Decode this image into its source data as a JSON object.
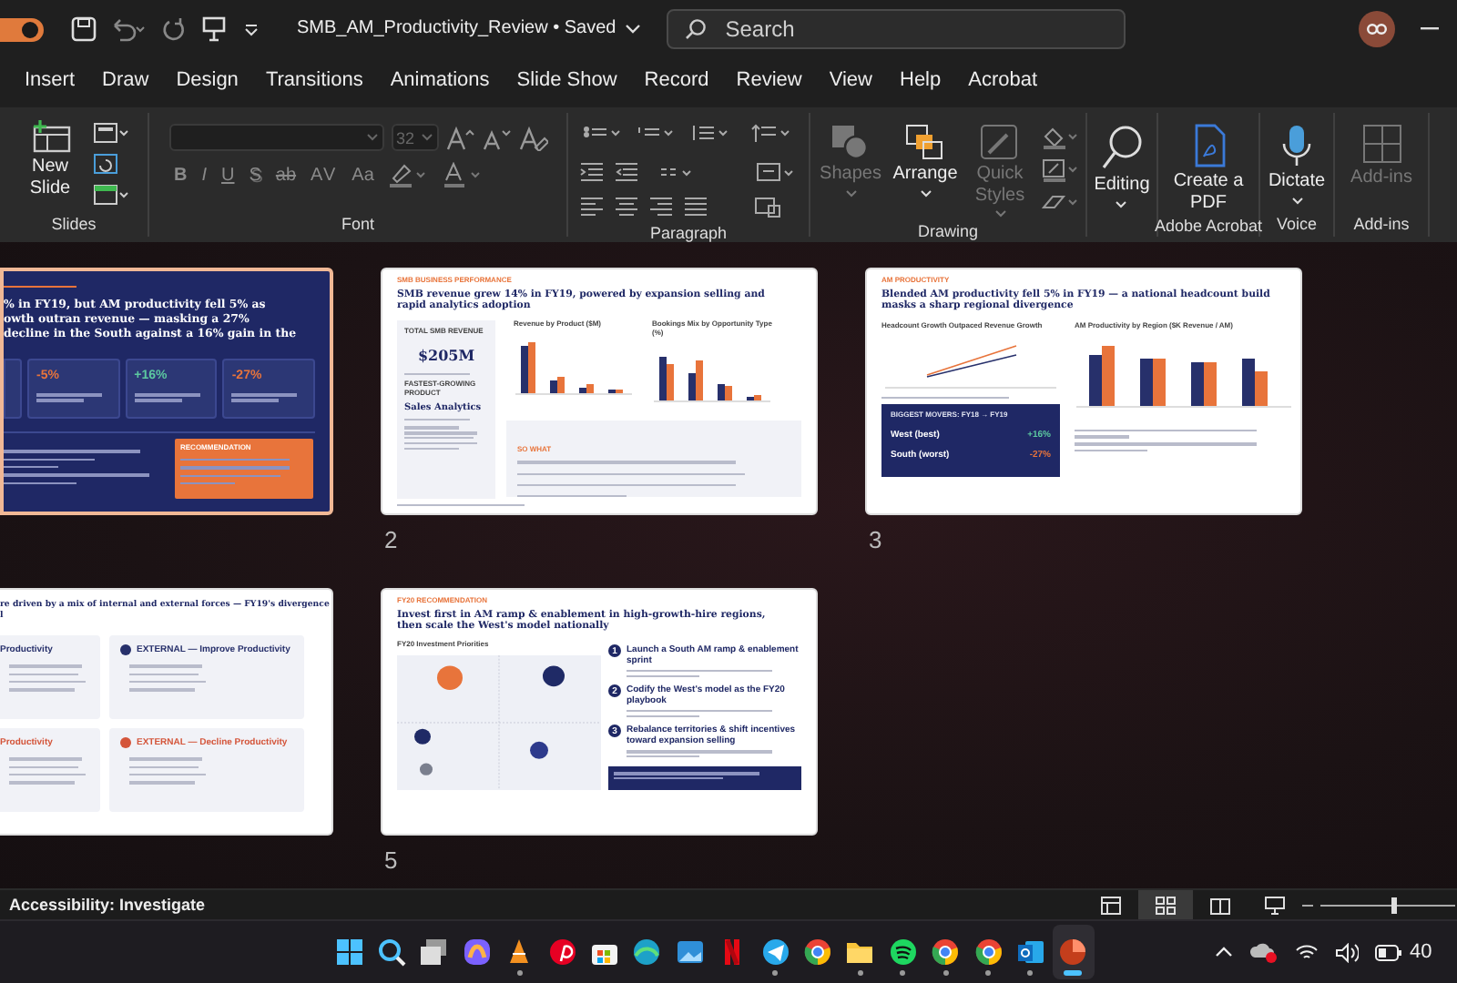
{
  "titlebar": {
    "autosave_on": true,
    "filename": "SMB_AM_Productivity_Review",
    "save_state": "• Saved",
    "search_placeholder": "Search"
  },
  "menu_tabs": [
    {
      "label": "Insert",
      "selected": false
    },
    {
      "label": "Draw",
      "selected": false
    },
    {
      "label": "Design",
      "selected": false
    },
    {
      "label": "Transitions",
      "selected": false
    },
    {
      "label": "Animations",
      "selected": false
    },
    {
      "label": "Slide Show",
      "selected": false
    },
    {
      "label": "Record",
      "selected": false
    },
    {
      "label": "Review",
      "selected": false
    },
    {
      "label": "View",
      "selected": false
    },
    {
      "label": "Help",
      "selected": false
    },
    {
      "label": "Acrobat",
      "selected": false
    }
  ],
  "ribbon": [
    {
      "kind": "slides",
      "label": "Slides",
      "buttons": [
        {
          "label": "New Slide",
          "disabled": false
        }
      ]
    },
    {
      "kind": "font",
      "label": "Font",
      "size": "32",
      "keys": [
        "B",
        "I",
        "U",
        "S",
        "ab",
        "AV",
        "Aa"
      ],
      "disabled": true
    },
    {
      "kind": "paragraph",
      "label": "Paragraph"
    },
    {
      "kind": "drawing",
      "label": "Drawing",
      "buttons": [
        {
          "label": "Shapes",
          "disabled": true
        },
        {
          "label": "Arrange",
          "disabled": false
        },
        {
          "label": "Quick Styles",
          "disabled": true
        }
      ]
    },
    {
      "kind": "single",
      "buttons": [
        {
          "label": "Editing",
          "disabled": false
        }
      ]
    },
    {
      "kind": "single",
      "label": "Adobe Acrobat",
      "buttons": [
        {
          "label": "Create a PDF",
          "disabled": false
        }
      ]
    },
    {
      "kind": "single",
      "label": "Voice",
      "buttons": [
        {
          "label": "Dictate",
          "disabled": false
        }
      ]
    },
    {
      "kind": "single",
      "label": "Add-ins",
      "buttons": [
        {
          "label": "Add-ins",
          "disabled": true
        }
      ]
    }
  ],
  "slides": [
    {
      "kind": "cover",
      "selected": true,
      "title_lines": [
        "% in FY19, but AM productivity fell 5% as",
        "owth outran revenue — masking a 27%",
        "decline in the South against a 16% gain in the"
      ],
      "stats": [
        {
          "value": "-5%",
          "color": "#e8743b"
        },
        {
          "value": "+16%",
          "color": "#5cc8a0"
        },
        {
          "value": "-27%",
          "color": "#e8743b"
        }
      ],
      "callout_label": "RECOMMENDATION"
    },
    {
      "kind": "dashboard",
      "selected": false,
      "number": "2",
      "eyebrow": "SMB BUSINESS PERFORMANCE",
      "title": "SMB revenue grew 14% in FY19, powered by expansion selling and rapid analytics adoption",
      "kpis": [
        {
          "label": "TOTAL SMB REVENUE",
          "value": "$205M"
        },
        {
          "label": "FASTEST-GROWING PRODUCT",
          "value": "Sales Analytics"
        }
      ],
      "charts": [
        "Revenue by Product ($M)",
        "Bookings Mix by Opportunity Type (%)"
      ],
      "callout_label": "SO WHAT"
    },
    {
      "kind": "regional",
      "selected": false,
      "number": "3",
      "eyebrow": "AM PRODUCTIVITY",
      "title": "Blended AM productivity fell 5% in FY19 — a national headcount build masks a sharp regional divergence",
      "charts": [
        "Headcount Growth Outpaced Revenue Growth",
        "AM Productivity by Region ($K Revenue / AM)"
      ],
      "movers_title": "BIGGEST MOVERS: FY18 → FY19",
      "movers": [
        {
          "name": "West (best)",
          "change": "+16%",
          "color": "#5cc8a0"
        },
        {
          "name": "South (worst)",
          "change": "-27%",
          "color": "#e8743b"
        }
      ]
    },
    {
      "kind": "drivers",
      "selected": false,
      "title_lines": [
        "re driven by a mix of internal and external forces — FY19's divergence",
        "l"
      ],
      "panels": [
        {
          "heading": "Productivity",
          "color": "#27306b",
          "dot": false
        },
        {
          "heading": "EXTERNAL — Improve Productivity",
          "color": "#27306b",
          "dot": true
        },
        {
          "heading": "Productivity",
          "color": "#d4553a",
          "dot": false
        },
        {
          "heading": "EXTERNAL — Decline Productivity",
          "color": "#d4553a",
          "dot": true
        }
      ]
    },
    {
      "kind": "recommendation",
      "selected": false,
      "number": "5",
      "eyebrow": "FY20 RECOMMENDATION",
      "title": "Invest first in AM ramp & enablement in high-growth-hire regions, then scale the West's model nationally",
      "matrix_title": "FY20 Investment Priorities",
      "steps": [
        {
          "num": "1",
          "title": "Launch a South AM ramp & enablement sprint"
        },
        {
          "num": "2",
          "title": "Codify the West's model as the FY20 playbook"
        },
        {
          "num": "3",
          "title": "Rebalance territories & shift incentives toward expansion selling"
        }
      ]
    }
  ],
  "status_bar": {
    "accessibility": "Accessibility: Investigate",
    "views": [
      {
        "selected": false
      },
      {
        "selected": true
      },
      {
        "selected": false
      },
      {
        "selected": false
      }
    ],
    "zoom": {
      "level": 0.55
    }
  },
  "taskbar": {
    "apps": [
      {
        "running": false,
        "active": false
      },
      {
        "running": false,
        "active": false
      },
      {
        "running": false,
        "active": false
      },
      {
        "running": false,
        "active": false
      },
      {
        "running": true,
        "active": false
      },
      {
        "running": false,
        "active": false
      },
      {
        "running": false,
        "active": false
      },
      {
        "running": false,
        "active": false
      },
      {
        "running": false,
        "active": false
      },
      {
        "running": false,
        "active": false
      },
      {
        "running": true,
        "active": false
      },
      {
        "running": false,
        "active": false
      },
      {
        "running": true,
        "active": false
      },
      {
        "running": true,
        "active": false
      },
      {
        "running": true,
        "active": false
      },
      {
        "running": true,
        "active": false
      },
      {
        "running": true,
        "active": false
      },
      {
        "running": true,
        "active": true
      }
    ],
    "battery": "40"
  }
}
